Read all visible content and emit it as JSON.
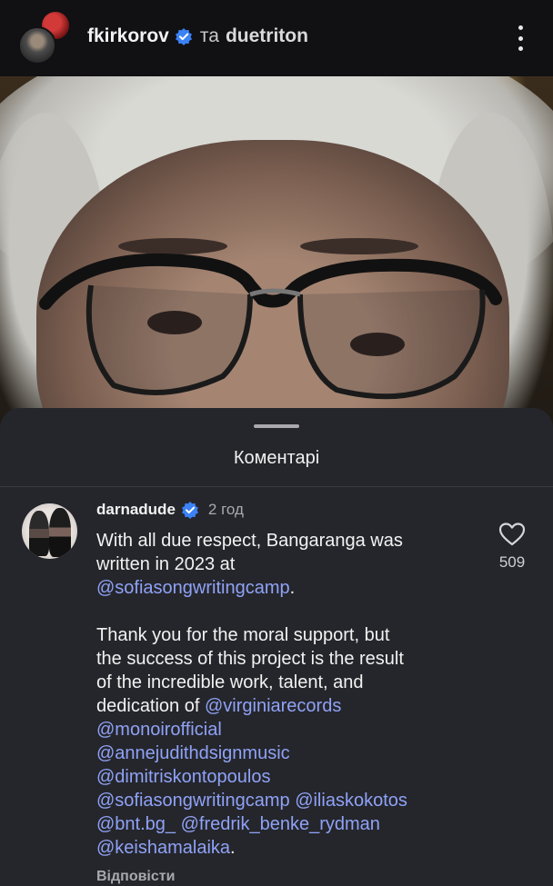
{
  "header": {
    "username": "fkirkorov",
    "conjunction": "та",
    "collaborator": "duetriton",
    "icons": [
      "avatar",
      "verified-badge-icon",
      "more-options-icon"
    ]
  },
  "colors": {
    "background": "#111114",
    "sheet": "#25262b",
    "mention": "#8fa2f7",
    "verified": "#3b82f6",
    "muted": "#a8a8ad"
  },
  "comments_sheet": {
    "title": "Коментарі",
    "comment": {
      "username": "darnadude",
      "time": "2 год",
      "likes": "509",
      "reply_label": "Відповісти",
      "lines": [
        [
          {
            "text": "With all due respect, Bangaranga was",
            "type": "text"
          }
        ],
        [
          {
            "text": "written in 2023 at",
            "type": "text"
          }
        ],
        [
          {
            "text": "@sofiasongwritingcamp",
            "type": "mention"
          },
          {
            "text": ".",
            "type": "text"
          }
        ],
        [],
        [
          {
            "text": "Thank you for the moral support, but",
            "type": "text"
          }
        ],
        [
          {
            "text": "the success of this project is the result",
            "type": "text"
          }
        ],
        [
          {
            "text": "of the incredible work, talent, and",
            "type": "text"
          }
        ],
        [
          {
            "text": "dedication of ",
            "type": "text"
          },
          {
            "text": "@virginiarecords",
            "type": "mention"
          }
        ],
        [
          {
            "text": "@monoirofficial",
            "type": "mention"
          }
        ],
        [
          {
            "text": "@annejudithdsignmusic",
            "type": "mention"
          }
        ],
        [
          {
            "text": "@dimitriskontopoulos",
            "type": "mention"
          }
        ],
        [
          {
            "text": "@sofiasongwritingcamp",
            "type": "mention"
          },
          {
            "text": " ",
            "type": "text"
          },
          {
            "text": "@iliaskokotos",
            "type": "mention"
          }
        ],
        [
          {
            "text": "@bnt.bg_",
            "type": "mention"
          },
          {
            "text": " ",
            "type": "text"
          },
          {
            "text": "@fredrik_benke_rydman",
            "type": "mention"
          }
        ],
        [
          {
            "text": "@keishamalaika",
            "type": "mention"
          },
          {
            "text": ".",
            "type": "text"
          }
        ]
      ]
    }
  }
}
